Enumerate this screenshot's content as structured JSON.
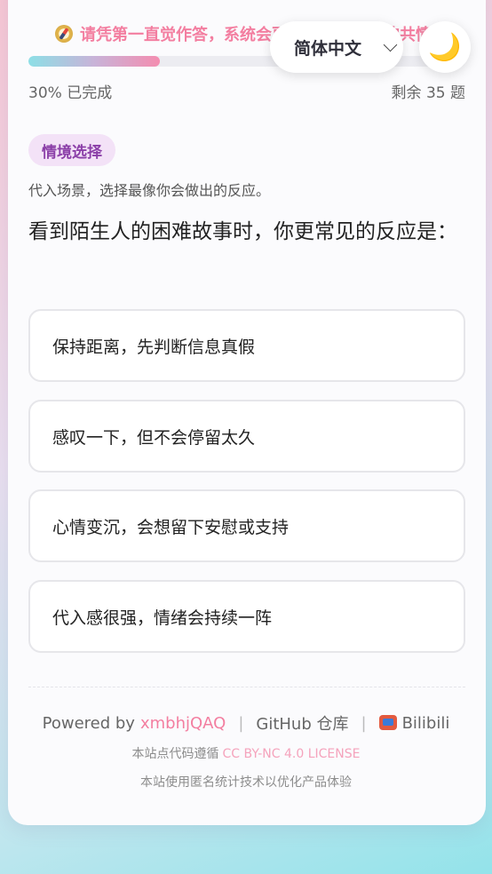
{
  "notice": {
    "text": "请凭第一直觉作答，系统会更精准地探测你的共情波动"
  },
  "language": {
    "selected": "简体中文"
  },
  "theme_toggle": {
    "icon": "moon-icon",
    "glyph": "🌙"
  },
  "progress": {
    "percent": 30,
    "done_label": "30% 已完成",
    "remaining_label": "剩余 35 题"
  },
  "section": {
    "tag": "情境选择",
    "hint": "代入场景，选择最像你会做出的反应。"
  },
  "question": {
    "text": "看到陌生人的困难故事时，你更常见的反应是："
  },
  "options": [
    {
      "label": "保持距离，先判断信息真假"
    },
    {
      "label": "感叹一下，但不会停留太久"
    },
    {
      "label": "心情变沉，会想留下安慰或支持"
    },
    {
      "label": "代入感很强，情绪会持续一阵"
    }
  ],
  "footer": {
    "powered_by": "Powered by",
    "author": "xmbhjQAQ",
    "sep": "|",
    "github": "GitHub 仓库",
    "bilibili": "Bilibili",
    "license_prefix": "本站点代码遵循",
    "license": "CC BY-NC 4.0 LICENSE",
    "analytics": "本站使用匿名统计技术以优化产品体验"
  },
  "colors": {
    "accent": "#f37ea0",
    "tag_bg": "#f3e2f7",
    "tag_text": "#8b3fa8"
  }
}
